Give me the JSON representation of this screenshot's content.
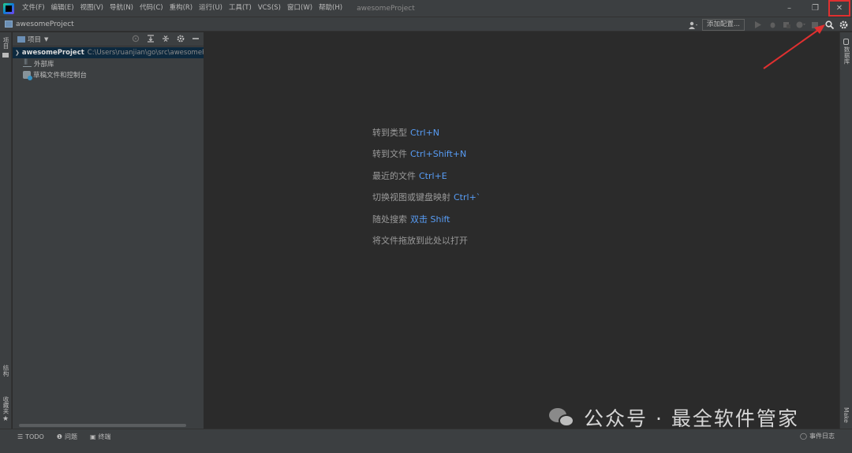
{
  "titlebar": {
    "menu": [
      "文件(F)",
      "编辑(E)",
      "视图(V)",
      "导航(N)",
      "代码(C)",
      "重构(R)",
      "运行(U)",
      "工具(T)",
      "VCS(S)",
      "窗口(W)",
      "帮助(H)"
    ],
    "window_title": "awesomeProject",
    "minimize": "–",
    "restore": "❐",
    "close": "✕"
  },
  "navbar": {
    "project": "awesomeProject",
    "add_config": "添加配置..."
  },
  "left_stripe": {
    "project_tab": "项目",
    "structure_tab": "结构",
    "favorites_tab": "收藏夹"
  },
  "project_panel": {
    "title": "项目",
    "tree": {
      "root_name": "awesomeProject",
      "root_path": "C:\\Users\\ruanjian\\go\\src\\awesomeProject",
      "external_libs": "外部库",
      "scratches": "草稿文件和控制台"
    }
  },
  "editor": {
    "hints": [
      {
        "label": "转到类型",
        "key": "Ctrl+N"
      },
      {
        "label": "转到文件",
        "key": "Ctrl+Shift+N"
      },
      {
        "label": "最近的文件",
        "key": "Ctrl+E"
      },
      {
        "label": "切换视图或键盘映射",
        "key": "Ctrl+`"
      },
      {
        "label": "随处搜索",
        "key": "双击 Shift"
      },
      {
        "label": "将文件拖放到此处以打开",
        "key": ""
      }
    ]
  },
  "right_stripe": {
    "database_tab": "数据库",
    "make_tab": "Make"
  },
  "bottombar": {
    "todo": "TODO",
    "problems": "问题",
    "terminal": "终端",
    "event_log": "事件日志"
  },
  "watermark": {
    "text": "公众号 · 最全软件管家"
  },
  "colors": {
    "bg_editor": "#2b2b2b",
    "bg_panel": "#3c3f41",
    "key_blue": "#589df6",
    "selection": "#0d293e",
    "annotation_red": "#e03030"
  }
}
